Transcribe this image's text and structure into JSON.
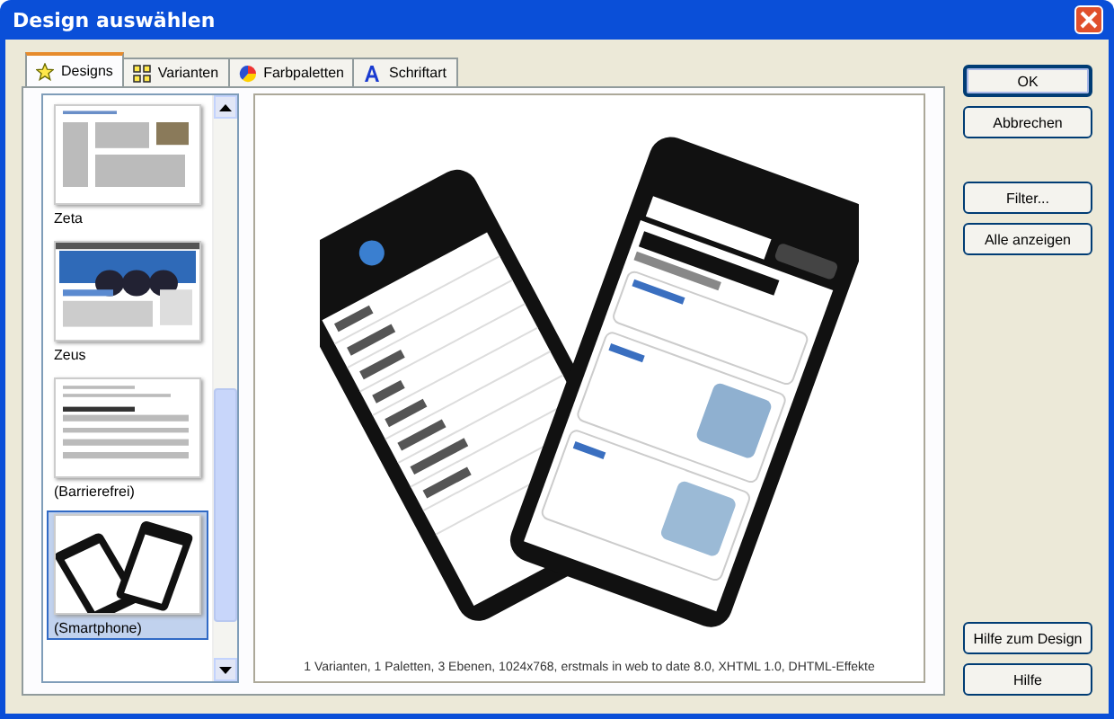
{
  "window": {
    "title": "Design auswählen"
  },
  "tabs": [
    {
      "label": "Designs",
      "kind": "star",
      "selected": true
    },
    {
      "label": "Varianten",
      "kind": "grid",
      "selected": false
    },
    {
      "label": "Farbpaletten",
      "kind": "palette",
      "selected": false
    },
    {
      "label": "Schriftart",
      "kind": "letter",
      "selected": false
    }
  ],
  "designs": [
    {
      "name": "Zeta",
      "kind": "site",
      "selected": false
    },
    {
      "name": "Zeus",
      "kind": "banner",
      "selected": false
    },
    {
      "name": "(Barrierefrei)",
      "kind": "text",
      "selected": false
    },
    {
      "name": "(Smartphone)",
      "kind": "phone",
      "selected": true
    }
  ],
  "preview": {
    "caption": "1 Varianten, 1 Paletten, 3 Ebenen, 1024x768, erstmals in web to date 8.0, XHTML 1.0, DHTML-Effekte"
  },
  "buttons_top": [
    {
      "label": "OK",
      "default": true
    },
    {
      "label": "Abbrechen",
      "default": false
    }
  ],
  "buttons_mid": [
    {
      "label": "Filter...",
      "default": false
    },
    {
      "label": "Alle anzeigen",
      "default": false
    }
  ],
  "buttons_bottom": [
    {
      "label": "Hilfe zum Design",
      "default": false
    },
    {
      "label": "Hilfe",
      "default": false
    }
  ]
}
